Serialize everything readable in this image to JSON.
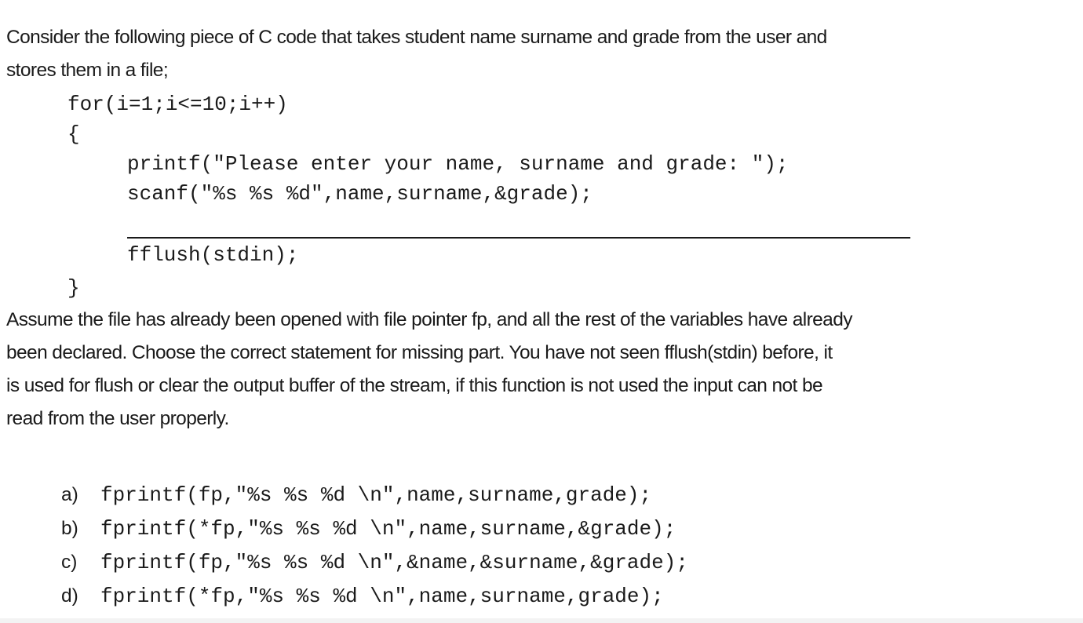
{
  "question": {
    "intro_lines": [
      "Consider the following piece of C code that takes student name surname and grade from the user and",
      "stores them in a file;"
    ],
    "code": {
      "for_line": "for(i=1;i<=10;i++)",
      "open_brace": "{",
      "printf_line": "printf(\"Please enter your name, surname and grade: \");",
      "scanf_line": "scanf(\"%s %s %d\",name,surname,&grade);",
      "missing_blank": "",
      "fflush_line": "fflush(stdin);",
      "close_brace": "}"
    },
    "description_lines": [
      "Assume the file has already been opened with file pointer fp, and all the rest of the variables have already",
      "been declared. Choose the correct statement for missing part. You have not seen fflush(stdin) before, it",
      "is used for flush or clear the output buffer of the stream, if this function is not used the input can not be",
      "read from the user properly."
    ],
    "options": [
      {
        "letter": "a)",
        "code": "fprintf(fp,\"%s %s %d \\n\",name,surname,grade);"
      },
      {
        "letter": "b)",
        "code": "fprintf(*fp,\"%s %s %d \\n\",name,surname,&grade);"
      },
      {
        "letter": "c)",
        "code": "fprintf(fp,\"%s %s %d \\n\",&name,&surname,&grade);"
      },
      {
        "letter": "d)",
        "code": "fprintf(*fp,\"%s %s %d \\n\",name,surname,grade);"
      }
    ]
  }
}
